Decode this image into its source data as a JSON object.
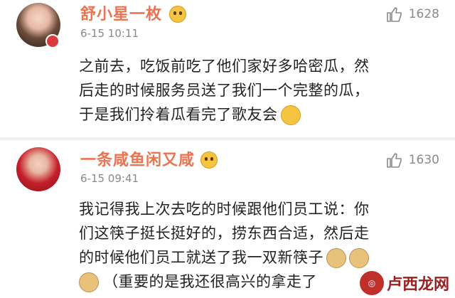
{
  "comments": [
    {
      "username": "舒小星一枚",
      "timestamp": "6-15 10:11",
      "likes": "1628",
      "lines": [
        "之前去，吃饭前吃了他们家好多哈密瓜，然",
        "后走的时候服务员送了我们一个完整的瓜，",
        "于是我们拎着瓜看完了歌友会"
      ],
      "emoji_icons": [
        "laugh-emoji-icon"
      ]
    },
    {
      "username": "一条咸鱼闲又咸",
      "timestamp": "6-15 09:41",
      "likes": "1630",
      "lines": [
        "我记得我上次去吃的时候跟他们员工说：你",
        "们这筷子挺长挺好的，捞东西合适，然后走",
        "的时候他们员工就送了我一双新筷子",
        "（重要的是我还很高兴的拿走了"
      ],
      "emoji_icons": [
        "doge-emoji-icon",
        "doge-emoji-icon",
        "doge-emoji-icon"
      ]
    }
  ],
  "watermark": {
    "text": "卢西龙网"
  },
  "colors": {
    "username": "#eb7350",
    "timestamp": "#8a8a8a",
    "body": "#222222",
    "divider": "#f0f0f0"
  }
}
